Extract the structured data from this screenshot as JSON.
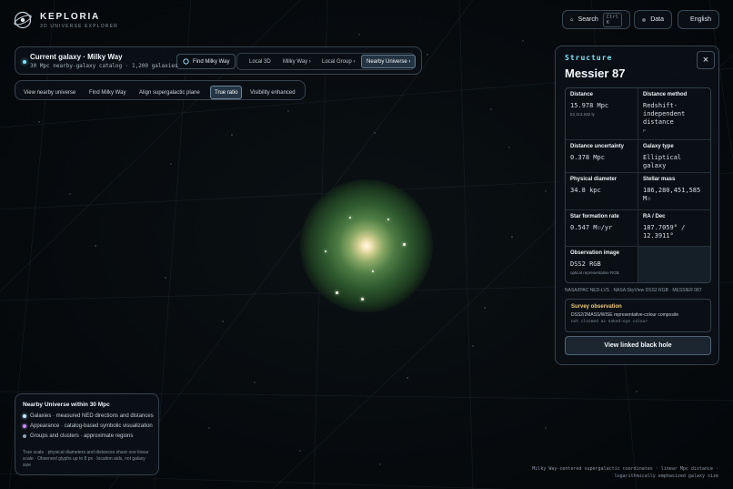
{
  "brand": {
    "title": "KEPLORIA",
    "subtitle": "3D UNIVERSE EXPLORER"
  },
  "topbar": {
    "search_label": "Search",
    "search_shortcut": "Ctrl K",
    "data_label": "Data",
    "language_label": "English"
  },
  "current_galaxy": {
    "title": "Current galaxy · Milky Way",
    "subtitle": "30 Mpc nearby-galaxy catalog · 1,200 galaxies",
    "find_button": "Find Milky Way",
    "scale_tabs": [
      {
        "label": "Local 3D",
        "active": false
      },
      {
        "label": "Milky Way ›",
        "active": false
      },
      {
        "label": "Local Group ›",
        "active": false
      },
      {
        "label": "Nearby Universe ›",
        "active": true
      }
    ]
  },
  "toolbar": {
    "items": [
      {
        "label": "View nearby universe",
        "active": false
      },
      {
        "label": "Find Milky Way",
        "active": false
      },
      {
        "label": "Align supergalactic plane",
        "active": false
      },
      {
        "label": "True ratio",
        "active": true
      },
      {
        "label": "Visibility enhanced",
        "active": false
      }
    ]
  },
  "detail_panel": {
    "section_label": "Structure",
    "title": "Messier 87",
    "close_label": "×",
    "fields": {
      "distance": {
        "label": "Distance",
        "value": "15.978 Mpc",
        "note": "52,113,632 ly"
      },
      "distance_method": {
        "label": "Distance method",
        "value": "Redshift-independent distance",
        "note": "P"
      },
      "distance_uncertainty": {
        "label": "Distance uncertainty",
        "value": "0.378 Mpc"
      },
      "galaxy_type": {
        "label": "Galaxy type",
        "value": "Elliptical galaxy"
      },
      "physical_diameter": {
        "label": "Physical diameter",
        "value": "34.8 kpc"
      },
      "stellar_mass": {
        "label": "Stellar mass",
        "value": "186,280,451,585 M☉"
      },
      "star_formation_rate": {
        "label": "Star formation rate",
        "value": "0.547 M☉/yr"
      },
      "ra_dec": {
        "label": "RA / Dec",
        "value": "187.7059° / 12.3911°"
      },
      "observation_image": {
        "label": "Observation image",
        "value": "DSS2 RGB",
        "note": "optical representative RGB"
      }
    },
    "sources": "NASA/IPAC NED-LVS · NASA SkyView DSS2 RGB · MESSIER 087",
    "survey": {
      "title": "Survey observation",
      "subtitle": "DSS2/2MASS/WISE representative-colour composite",
      "note": "not claimed as naked-eye colour"
    },
    "black_hole_button": "View linked black hole"
  },
  "legend": {
    "title": "Nearby Universe within 30 Mpc",
    "items": [
      {
        "label": "Galaxies · measured NED directions and distances",
        "color": "#bfe9ff"
      },
      {
        "label": "Appearance · catalog-based symbolic visualization",
        "color": "#c98aff"
      },
      {
        "label": "Groups and clusters · approximate regions",
        "color": "#8fa3b3"
      }
    ],
    "note": "True scale · physical diameters and distances share one linear scale · Observed glyphs up to 8 px · location aids, not galaxy size"
  },
  "footer": {
    "line1": "Milky Way-centered supergalactic coordinates · linear Mpc distance ·",
    "line2": "logarithmically emphasized galaxy size"
  },
  "colors": {
    "accent": "#7de3ff",
    "survey_title": "#f0c97a",
    "background": "#05080b"
  }
}
